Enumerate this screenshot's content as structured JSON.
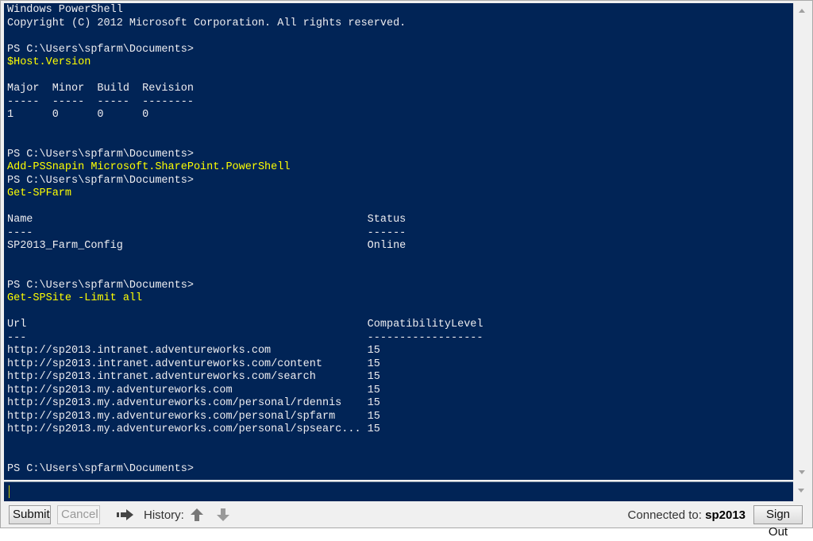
{
  "console": {
    "lines": [
      {
        "text": "Windows PowerShell",
        "type": "out"
      },
      {
        "text": "Copyright (C) 2012 Microsoft Corporation. All rights reserved.",
        "type": "out"
      },
      {
        "text": "",
        "type": "out"
      },
      {
        "text": "PS C:\\Users\\spfarm\\Documents>",
        "type": "out"
      },
      {
        "text": "$Host.Version",
        "type": "cmd"
      },
      {
        "text": "",
        "type": "out"
      },
      {
        "text": "Major  Minor  Build  Revision",
        "type": "out"
      },
      {
        "text": "-----  -----  -----  --------",
        "type": "out"
      },
      {
        "text": "1      0      0      0",
        "type": "out"
      },
      {
        "text": "",
        "type": "out"
      },
      {
        "text": "",
        "type": "out"
      },
      {
        "text": "PS C:\\Users\\spfarm\\Documents>",
        "type": "out"
      },
      {
        "text": "Add-PSSnapin Microsoft.SharePoint.PowerShell",
        "type": "cmd"
      },
      {
        "text": "PS C:\\Users\\spfarm\\Documents>",
        "type": "out"
      },
      {
        "text": "Get-SPFarm",
        "type": "cmd"
      },
      {
        "text": "",
        "type": "out"
      },
      {
        "text": "Name                                                    Status",
        "type": "out"
      },
      {
        "text": "----                                                    ------",
        "type": "out"
      },
      {
        "text": "SP2013_Farm_Config                                      Online",
        "type": "out"
      },
      {
        "text": "",
        "type": "out"
      },
      {
        "text": "",
        "type": "out"
      },
      {
        "text": "PS C:\\Users\\spfarm\\Documents>",
        "type": "out"
      },
      {
        "text": "Get-SPSite -Limit all",
        "type": "cmd"
      },
      {
        "text": "",
        "type": "out"
      },
      {
        "text": "Url                                                     CompatibilityLevel",
        "type": "out"
      },
      {
        "text": "---                                                     ------------------",
        "type": "out"
      },
      {
        "text": "http://sp2013.intranet.adventureworks.com               15",
        "type": "out"
      },
      {
        "text": "http://sp2013.intranet.adventureworks.com/content       15",
        "type": "out"
      },
      {
        "text": "http://sp2013.intranet.adventureworks.com/search        15",
        "type": "out"
      },
      {
        "text": "http://sp2013.my.adventureworks.com                     15",
        "type": "out"
      },
      {
        "text": "http://sp2013.my.adventureworks.com/personal/rdennis    15",
        "type": "out"
      },
      {
        "text": "http://sp2013.my.adventureworks.com/personal/spfarm     15",
        "type": "out"
      },
      {
        "text": "http://sp2013.my.adventureworks.com/personal/spsearc... 15",
        "type": "out"
      },
      {
        "text": "",
        "type": "out"
      },
      {
        "text": "",
        "type": "out"
      },
      {
        "text": "PS C:\\Users\\spfarm\\Documents>",
        "type": "out"
      }
    ]
  },
  "input": {
    "value": ""
  },
  "toolbar": {
    "submit_label": "Submit",
    "cancel_label": "Cancel",
    "history_label": "History:",
    "connected_label": "Connected to:",
    "connected_server": "sp2013",
    "signout_label": "Sign Out"
  },
  "icons": {
    "run": "run-arrow-icon",
    "history_up": "arrow-up-icon",
    "history_down": "arrow-down-icon"
  },
  "colors": {
    "console_bg": "#012456",
    "console_text": "#eeedf0",
    "command_text": "#ffff00"
  }
}
